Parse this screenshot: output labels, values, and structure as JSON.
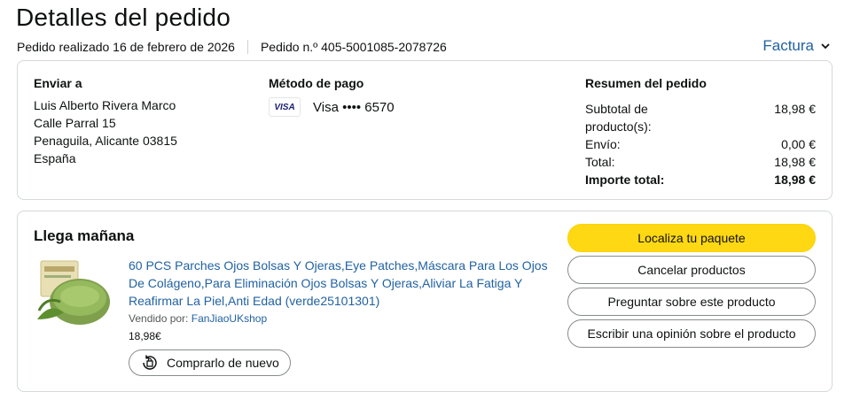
{
  "header": {
    "title": "Detalles del pedido",
    "order_date": "Pedido realizado 16 de febrero de 2026",
    "order_number": "Pedido n.º 405-5001085-2078726",
    "invoice_label": "Factura"
  },
  "shipping": {
    "title": "Enviar a",
    "lines": [
      "Luis Alberto Rivera Marco",
      "Calle Parral 15",
      "Penaguila, Alicante 03815",
      "España"
    ]
  },
  "payment": {
    "title": "Método de pago",
    "card_brand": "VISA",
    "card_text": "Visa •••• 6570"
  },
  "summary": {
    "title": "Resumen del pedido",
    "rows": [
      {
        "label": "Subtotal de producto(s):",
        "value": "18,98 €"
      },
      {
        "label": "Envío:",
        "value": "0,00 €"
      },
      {
        "label": "Total:",
        "value": "18,98 €"
      },
      {
        "label": "Importe total:",
        "value": "18,98 €"
      }
    ]
  },
  "delivery": {
    "status": "Llega mañana",
    "product_title": "60 PCS Parches Ojos Bolsas Y Ojeras,Eye Patches,Máscara Para Los Ojos De Colágeno,Para Eliminación Ojos Bolsas Y Ojeras,Aliviar La Fatiga Y Reafirmar La Piel,Anti Edad (verde25101301)",
    "seller_prefix": "Vendido por:",
    "seller_name": "FanJiaoUKshop",
    "price": "18,98€",
    "rebuy_label": "Comprarlo de nuevo",
    "actions": [
      "Localiza tu paquete",
      "Cancelar productos",
      "Preguntar sobre este producto",
      "Escribir una opinión sobre el producto"
    ]
  },
  "colors": {
    "accent_link": "#2162a1",
    "primary_button": "#ffd814",
    "border": "#d5d9d9"
  },
  "icons": {
    "invoice": "chevron-down-icon",
    "rebuy": "reorder-bag-icon"
  }
}
